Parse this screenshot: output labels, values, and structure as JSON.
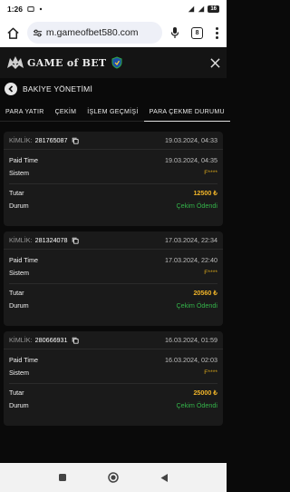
{
  "status_bar": {
    "time": "1:26",
    "battery": "16"
  },
  "browser": {
    "url": "m.gameofbet580.com",
    "tab_count": "8"
  },
  "site": {
    "logo_text": "GAME of BET"
  },
  "page": {
    "title": "BAKİYE YÖNETİMİ"
  },
  "tabs": [
    {
      "label": "PARA YATIR"
    },
    {
      "label": "ÇEKİM"
    },
    {
      "label": "İŞLEM GEÇMİŞİ"
    },
    {
      "label": "PARA ÇEKME DURUMU"
    }
  ],
  "cards": [
    {
      "kimlik_label": "KİMLİK:",
      "kimlik": "281765087",
      "date": "19.03.2024, 04:33",
      "paid_time_label": "Paid Time",
      "paid_time": "19.03.2024, 04:35",
      "sistem_label": "Sistem",
      "sistem": "F****",
      "tutar_label": "Tutar",
      "tutar": "12500 ₺",
      "durum_label": "Durum",
      "durum": "Çekim Ödendi"
    },
    {
      "kimlik_label": "KİMLİK:",
      "kimlik": "281324078",
      "date": "17.03.2024, 22:34",
      "paid_time_label": "Paid Time",
      "paid_time": "17.03.2024, 22:40",
      "sistem_label": "Sistem",
      "sistem": "F****",
      "tutar_label": "Tutar",
      "tutar": "20560 ₺",
      "durum_label": "Durum",
      "durum": "Çekim Ödendi"
    },
    {
      "kimlik_label": "KİMLİK:",
      "kimlik": "280666931",
      "date": "16.03.2024, 01:59",
      "paid_time_label": "Paid Time",
      "paid_time": "16.03.2024, 02:03",
      "sistem_label": "Sistem",
      "sistem": "F****",
      "tutar_label": "Tutar",
      "tutar": "25000 ₺",
      "durum_label": "Durum",
      "durum": "Çekim Ödendi"
    }
  ],
  "colors": {
    "amount": "#f0b429",
    "status_paid": "#34b34a",
    "background": "#0a0a0a",
    "card": "#1a1a1a"
  },
  "icons": {
    "home": "home-icon",
    "site_info": "site-info-icon",
    "mic": "mic-icon",
    "menu": "more-vert-icon",
    "close": "close-icon",
    "back": "back-arrow-icon",
    "copy": "copy-icon"
  }
}
